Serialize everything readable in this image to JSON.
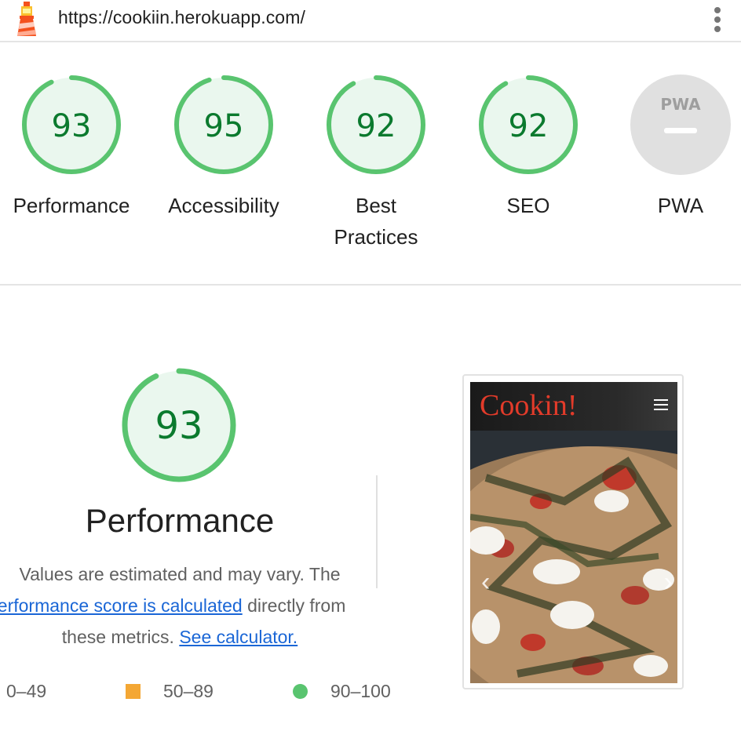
{
  "header": {
    "url": "https://cookiin.herokuapp.com/",
    "logo_icon": "lighthouse-icon",
    "menu_icon": "kebab-menu-icon"
  },
  "gauges": [
    {
      "score": "93",
      "label": "Performance",
      "value": 93
    },
    {
      "score": "95",
      "label": "Accessibility",
      "value": 95
    },
    {
      "score": "92",
      "label": "Best Practices",
      "label_line1": "Best",
      "label_line2": "Practices",
      "value": 92
    },
    {
      "score": "92",
      "label": "SEO",
      "value": 92
    },
    {
      "score": "",
      "label": "PWA",
      "badge": "PWA"
    }
  ],
  "performance": {
    "score": "93",
    "value": 93,
    "title": "Performance",
    "desc_line1": "Values are estimated and may vary. The",
    "link1": "performance score is calculated",
    "desc_line2_rest": " directly from",
    "desc_line3": "these metrics.",
    "link2": "See calculator."
  },
  "legend": [
    {
      "label": "0–49",
      "color": "#ff4e42"
    },
    {
      "label": "50–89",
      "color": "#f4a734"
    },
    {
      "label": "90–100",
      "color": "#59c46f"
    }
  ],
  "screenshot": {
    "brand": "Cookin!",
    "prev": "‹",
    "next": "›"
  },
  "colors": {
    "pass": "#59c46f",
    "pass_text": "#0b7a2e",
    "pass_bg": "#eaf7ee",
    "average": "#f4a734",
    "link": "#1a66d6"
  }
}
